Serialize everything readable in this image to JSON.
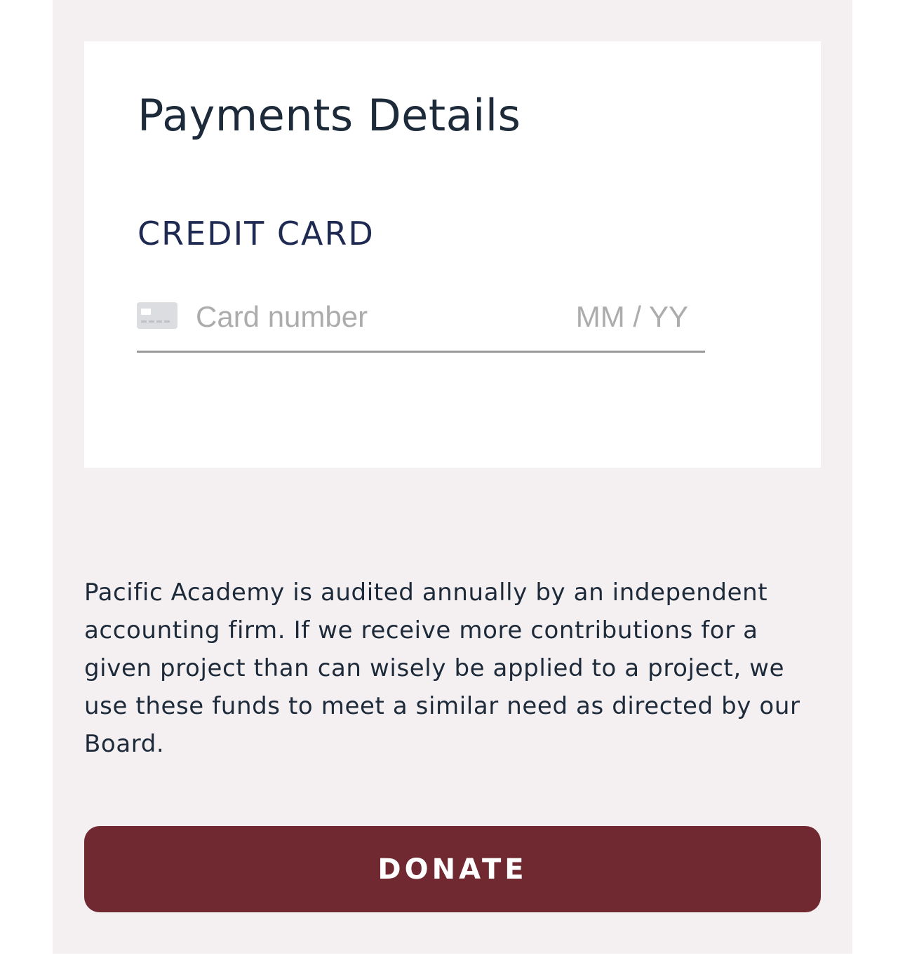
{
  "payment": {
    "title": "Payments Details",
    "section_label": "CREDIT CARD",
    "card_number_placeholder": "Card number",
    "card_number_value": "",
    "expiry_placeholder": "MM / YY",
    "expiry_value": "",
    "card_icon": "credit-card-icon"
  },
  "disclaimer": "Pacific Academy is audited annually by an independent accounting firm. If we receive more contributions for a given project than can wisely be applied to a project, we use these funds to meet a similar need as directed by our Board.",
  "donate_button": {
    "label": "DONATE"
  },
  "colors": {
    "panel_background": "#f4f0f1",
    "card_background": "#ffffff",
    "heading_text": "#1d2a3a",
    "section_label": "#1e2a52",
    "placeholder": "#acacac",
    "donate_button": "#712931"
  }
}
